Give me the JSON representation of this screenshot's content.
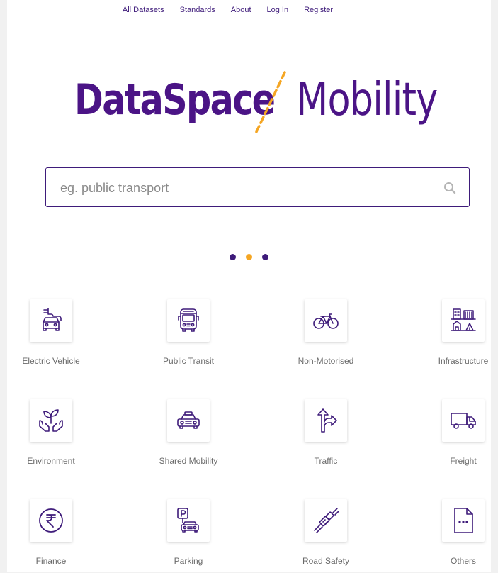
{
  "nav": {
    "items": [
      "All Datasets",
      "Standards",
      "About",
      "Log In",
      "Register"
    ]
  },
  "logo": {
    "part1": "DataSpace",
    "part2": "Mobility"
  },
  "colors": {
    "brand": "#4b1486",
    "accent": "#f5a623",
    "label": "#6a6a6a"
  },
  "search": {
    "placeholder": "eg. public transport",
    "value": "",
    "icon": "search-icon"
  },
  "carousel": {
    "dots": 3,
    "active_index": 1
  },
  "categories": [
    {
      "label": "Electric Vehicle",
      "icon": "electric-vehicle-icon"
    },
    {
      "label": "Public Transit",
      "icon": "bus-icon"
    },
    {
      "label": "Non-Motorised",
      "icon": "bicycle-icon"
    },
    {
      "label": "Infrastructure",
      "icon": "buildings-icon"
    },
    {
      "label": "Environment",
      "icon": "plant-hands-icon"
    },
    {
      "label": "Shared Mobility",
      "icon": "taxi-icon"
    },
    {
      "label": "Traffic",
      "icon": "direction-arrows-icon"
    },
    {
      "label": "Freight",
      "icon": "truck-icon"
    },
    {
      "label": "Finance",
      "icon": "rupee-icon"
    },
    {
      "label": "Parking",
      "icon": "parking-icon"
    },
    {
      "label": "Road Safety",
      "icon": "seatbelt-icon"
    },
    {
      "label": "Others",
      "icon": "document-icon"
    }
  ]
}
